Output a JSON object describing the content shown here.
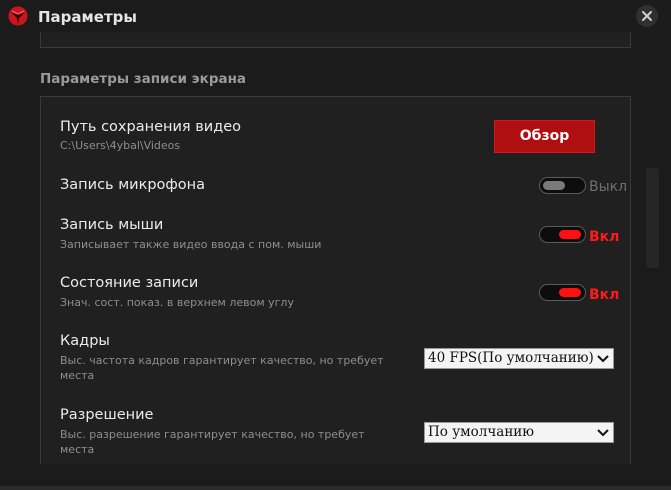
{
  "window": {
    "title": "Параметры"
  },
  "section": {
    "heading": "Параметры записи экрана"
  },
  "save_path": {
    "title": "Путь сохранения видео",
    "value": "C:\\Users\\4ybal\\Videos",
    "browse_label": "Обзор"
  },
  "microphone": {
    "title": "Запись микрофона",
    "state_label": "Выкл",
    "enabled": false
  },
  "mouse": {
    "title": "Запись мыши",
    "subtitle": "Записывает также видео ввода с пом. мыши",
    "state_label": "Вкл",
    "enabled": true
  },
  "status": {
    "title": "Состояние записи",
    "subtitle": "Знач. сост. показ. в верхнем левом углу",
    "state_label": "Вкл",
    "enabled": true
  },
  "frames": {
    "title": "Кадры",
    "subtitle": "Выс. частота кадров гарантирует качество, но требует места",
    "selected": "40 FPS(По умолчанию)"
  },
  "resolution": {
    "title": "Разрешение",
    "subtitle": "Выс. разрешение гарантирует качество, но требует места",
    "selected": "По умолчанию"
  },
  "colors": {
    "accent": "#b00f12",
    "toggle_on": "#ff1010",
    "background": "#1b1b1b",
    "panel": "#202020"
  },
  "icons": {
    "logo": "app-logo-icon",
    "close": "close-icon",
    "dropdown": "chevron-down-icon"
  }
}
